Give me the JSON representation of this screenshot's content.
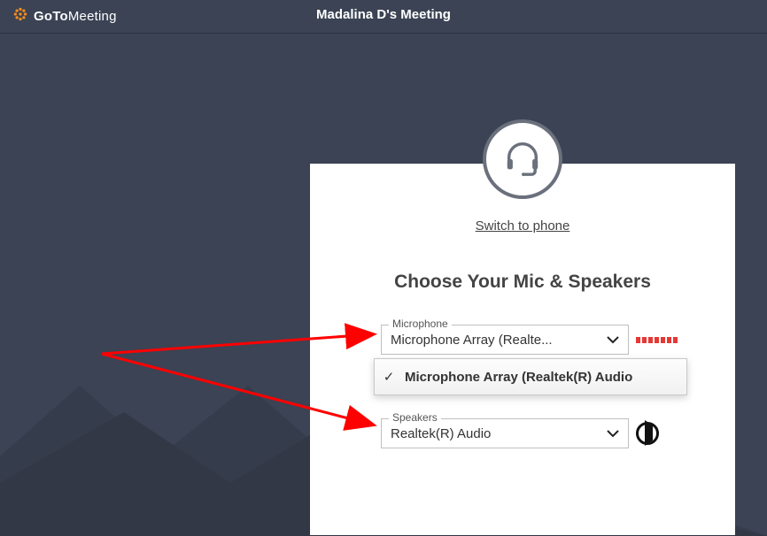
{
  "header": {
    "brand_bold": "GoTo",
    "brand_thin": "Meeting",
    "meeting_title": "Madalina D's Meeting"
  },
  "card": {
    "switch_link": "Switch to phone",
    "title": "Choose Your Mic & Speakers"
  },
  "mic": {
    "legend": "Microphone",
    "selected": "Microphone Array (Realte...",
    "dropdown_option": "Microphone Array (Realtek(R) Audio"
  },
  "speakers": {
    "legend": "Speakers",
    "selected": "Realtek(R) Audio"
  }
}
